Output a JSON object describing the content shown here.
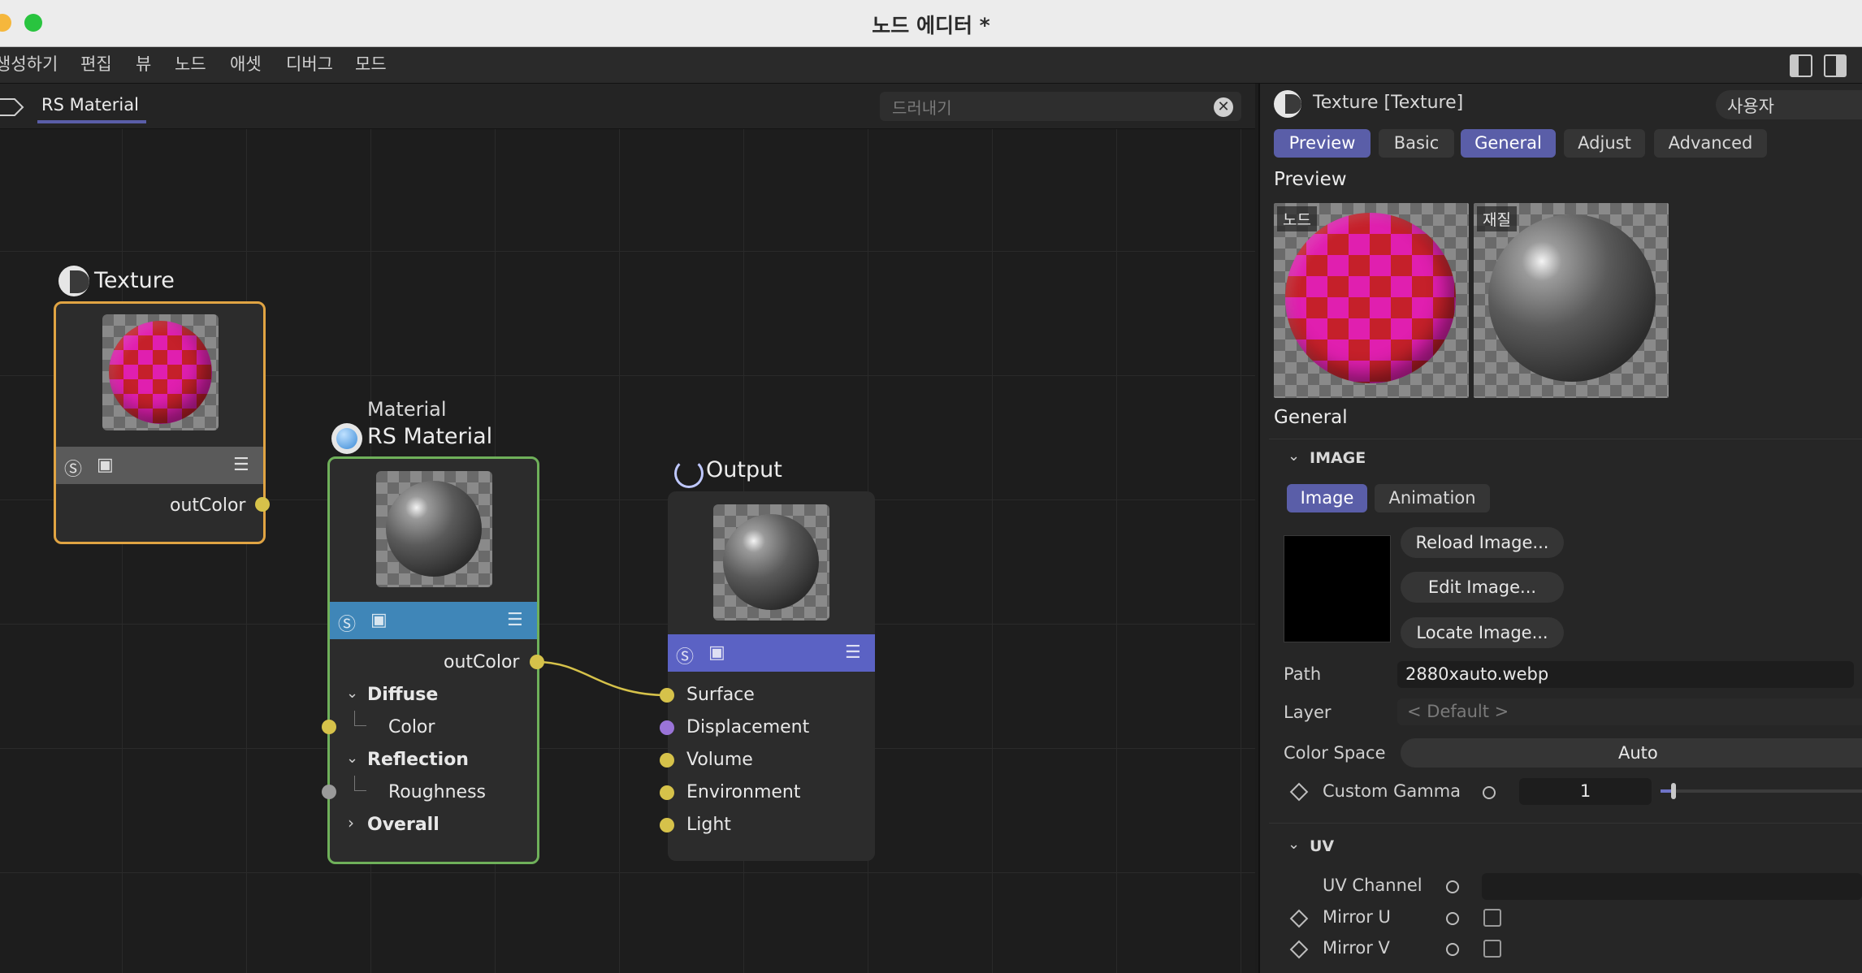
{
  "window": {
    "title": "노드 에디터 *"
  },
  "menu": [
    "생성하기",
    "편집",
    "뷰",
    "노드",
    "애셋",
    "디버그",
    "모드"
  ],
  "tab": {
    "label": "RS Material"
  },
  "search": {
    "placeholder": "드러내기"
  },
  "nodes": {
    "texture": {
      "title": "Texture",
      "output": "outColor"
    },
    "material": {
      "subtitle": "Material",
      "title": "RS Material",
      "output": "outColor",
      "groups": [
        {
          "label": "Diffuse",
          "child": "Color"
        },
        {
          "label": "Reflection",
          "child": "Roughness"
        }
      ],
      "collapsed": "Overall"
    },
    "output": {
      "title": "Output",
      "inputs": [
        "Surface",
        "Displacement",
        "Volume",
        "Environment",
        "Light"
      ]
    }
  },
  "panel": {
    "header": "Texture [Texture]",
    "mode": "사용자",
    "tabs": [
      "Preview",
      "Basic",
      "General",
      "Adjust",
      "Advanced"
    ],
    "preview_title": "Preview",
    "preview_labels": [
      "노드",
      "재질"
    ],
    "general_title": "General",
    "image_section": "IMAGE",
    "image_tabs": [
      "Image",
      "Animation"
    ],
    "buttons": [
      "Reload Image...",
      "Edit Image...",
      "Locate Image..."
    ],
    "path_label": "Path",
    "path_value": "2880xauto.webp",
    "layer_label": "Layer",
    "layer_value": "< Default >",
    "colorspace_label": "Color Space",
    "colorspace_value": "Auto",
    "gamma_label": "Custom Gamma",
    "gamma_value": "1",
    "uv_section": "UV",
    "uv_channel_label": "UV Channel",
    "mirror_u_label": "Mirror U",
    "mirror_v_label": "Mirror V"
  },
  "colors": {
    "accent": "#5a5ea8",
    "port": "#d6c24a",
    "texture_border": "#e0a443",
    "material_border": "#6fb05a",
    "material_bar": "#3f86b8",
    "output_bar": "#5b62c4"
  }
}
